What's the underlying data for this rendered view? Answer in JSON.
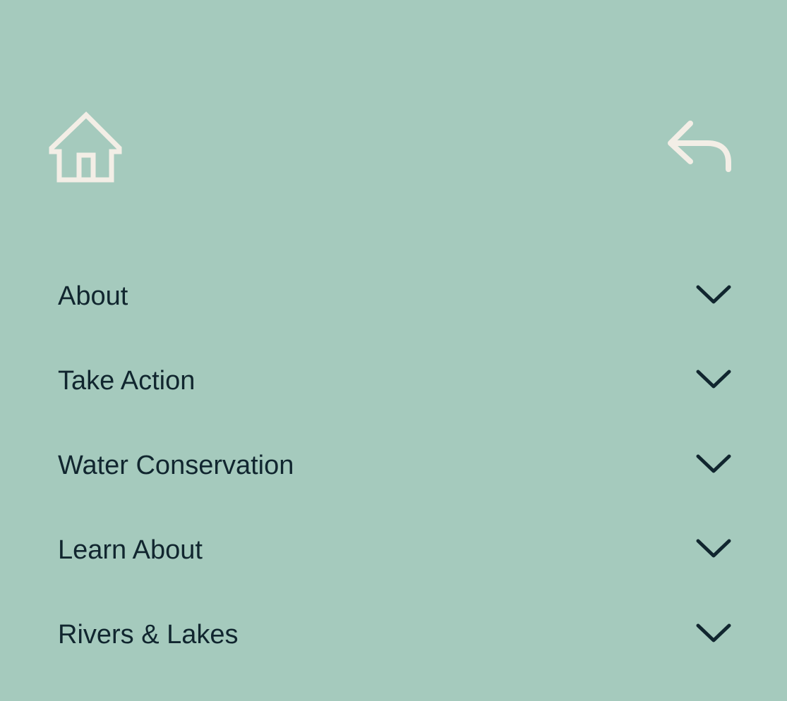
{
  "colors": {
    "background": "#a5cabd",
    "text": "#11262f",
    "icon_light": "#f3eee6"
  },
  "header": {
    "home_icon": "home-icon",
    "back_icon": "reply-back-icon"
  },
  "menu": {
    "items": [
      {
        "label": "About",
        "icon": "chevron-down-icon"
      },
      {
        "label": "Take Action",
        "icon": "chevron-down-icon"
      },
      {
        "label": "Water Conservation",
        "icon": "chevron-down-icon"
      },
      {
        "label": "Learn About",
        "icon": "chevron-down-icon"
      },
      {
        "label": "Rivers & Lakes",
        "icon": "chevron-down-icon"
      }
    ]
  }
}
